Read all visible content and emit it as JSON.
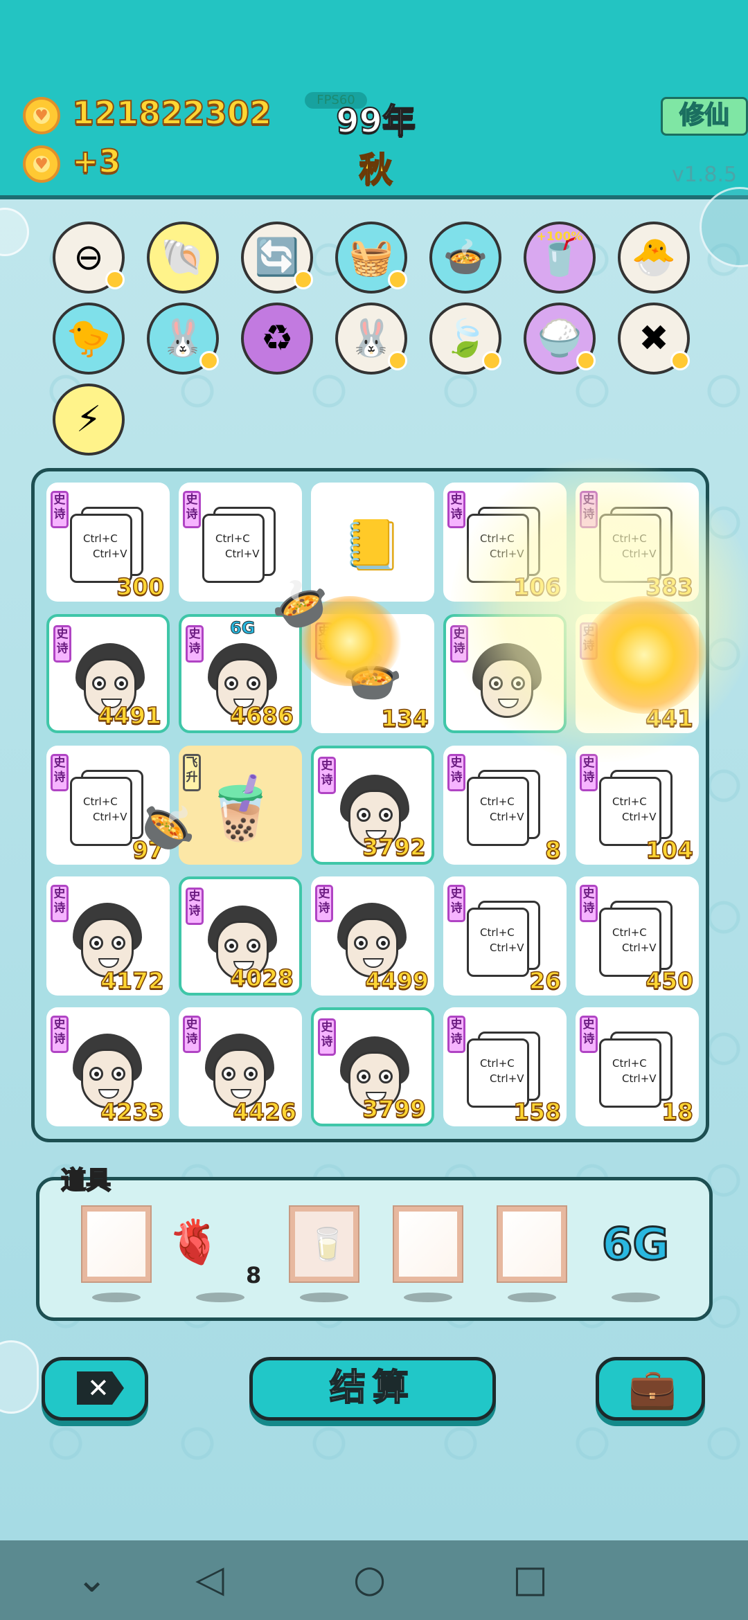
{
  "header": {
    "gold": "121822302",
    "gold_income": "+3",
    "fps": "FPS60",
    "year": "99年",
    "season": "秋",
    "mode_button": "修仙",
    "version": "v1.8.5"
  },
  "symbols": [
    {
      "name": "minus-symbol",
      "glyph": "⊖",
      "bg": "#f5f0e6",
      "badge": true
    },
    {
      "name": "shell-symbol",
      "glyph": "🐚",
      "bg": "#fff38a",
      "badge": false
    },
    {
      "name": "refresh-symbol",
      "glyph": "🔄",
      "bg": "#f5f0e6",
      "badge": true
    },
    {
      "name": "basket-symbol",
      "glyph": "🧺",
      "bg": "#7fe0ea",
      "badge": true
    },
    {
      "name": "pot-symbol",
      "glyph": "🍲",
      "bg": "#7fe0ea",
      "badge": false
    },
    {
      "name": "cup-symbol",
      "glyph": "🥤",
      "bg": "#d9a8f0",
      "badge": false,
      "label": "+100%"
    },
    {
      "name": "chick-egg-symbol",
      "glyph": "🐣",
      "bg": "#f5f0e6",
      "badge": false
    },
    {
      "name": "chick-symbol",
      "glyph": "🐤",
      "bg": "#7fe0ea",
      "badge": false
    },
    {
      "name": "rabbit-symbol",
      "glyph": "🐰",
      "bg": "#7fe0ea",
      "badge": true
    },
    {
      "name": "recycle-symbol",
      "glyph": "♻",
      "bg": "#c27ae0",
      "badge": false
    },
    {
      "name": "rabbit-symbol-2",
      "glyph": "🐰",
      "bg": "#f5f0e6",
      "badge": true
    },
    {
      "name": "leaf-symbol",
      "glyph": "🍃",
      "bg": "#f5f0e6",
      "badge": true
    },
    {
      "name": "rice-symbol",
      "glyph": "🍚",
      "bg": "#d9a8f0",
      "badge": true
    },
    {
      "name": "delete-symbol",
      "glyph": "✖",
      "bg": "#f5f0e6",
      "badge": true
    },
    {
      "name": "lightning-symbol",
      "glyph": "⚡",
      "bg": "#fff38a",
      "badge": false
    }
  ],
  "board": {
    "tag_shi": "史诗",
    "tag_fei": "飞升",
    "copy_text_1": "Ctrl+C",
    "copy_text_2": "Ctrl+V",
    "badge_6g": "6G",
    "cells": [
      {
        "type": "copy",
        "tag": "shi",
        "value": "300",
        "style": ""
      },
      {
        "type": "copy",
        "tag": "shi",
        "value": "",
        "style": ""
      },
      {
        "type": "book",
        "tag": "",
        "value": "",
        "style": ""
      },
      {
        "type": "copy",
        "tag": "shi",
        "value": "106",
        "style": ""
      },
      {
        "type": "copy",
        "tag": "shi",
        "value": "383",
        "style": ""
      },
      {
        "type": "face",
        "tag": "shi",
        "value": "4491",
        "style": "teal"
      },
      {
        "type": "face",
        "tag": "shi",
        "value": "4686",
        "style": "teal",
        "extra": "6G"
      },
      {
        "type": "pot",
        "tag": "shi",
        "value": "134",
        "style": ""
      },
      {
        "type": "face",
        "tag": "shi",
        "value": "",
        "style": "teal"
      },
      {
        "type": "blank",
        "tag": "shi",
        "value": "441",
        "style": ""
      },
      {
        "type": "copy",
        "tag": "shi",
        "value": "97",
        "style": ""
      },
      {
        "type": "cup",
        "tag": "fei",
        "value": "",
        "style": "gold"
      },
      {
        "type": "face",
        "tag": "shi",
        "value": "3792",
        "style": "teal"
      },
      {
        "type": "copy",
        "tag": "shi",
        "value": "8",
        "style": ""
      },
      {
        "type": "copy",
        "tag": "shi",
        "value": "104",
        "style": ""
      },
      {
        "type": "face",
        "tag": "shi",
        "value": "4172",
        "style": ""
      },
      {
        "type": "face",
        "tag": "shi",
        "value": "4028",
        "style": "teal"
      },
      {
        "type": "face",
        "tag": "shi",
        "value": "4499",
        "style": ""
      },
      {
        "type": "copy",
        "tag": "shi",
        "value": "26",
        "style": ""
      },
      {
        "type": "copy",
        "tag": "shi",
        "value": "450",
        "style": ""
      },
      {
        "type": "face",
        "tag": "shi",
        "value": "4233",
        "style": ""
      },
      {
        "type": "face",
        "tag": "shi",
        "value": "4426",
        "style": ""
      },
      {
        "type": "face",
        "tag": "shi",
        "value": "3799",
        "style": "teal"
      },
      {
        "type": "copy",
        "tag": "shi",
        "value": "158",
        "style": ""
      },
      {
        "type": "copy",
        "tag": "shi",
        "value": "18",
        "style": ""
      }
    ]
  },
  "props": {
    "label": "道具",
    "liver_count": "8",
    "six_g": "6G"
  },
  "actions": {
    "settle_label": "结算"
  }
}
